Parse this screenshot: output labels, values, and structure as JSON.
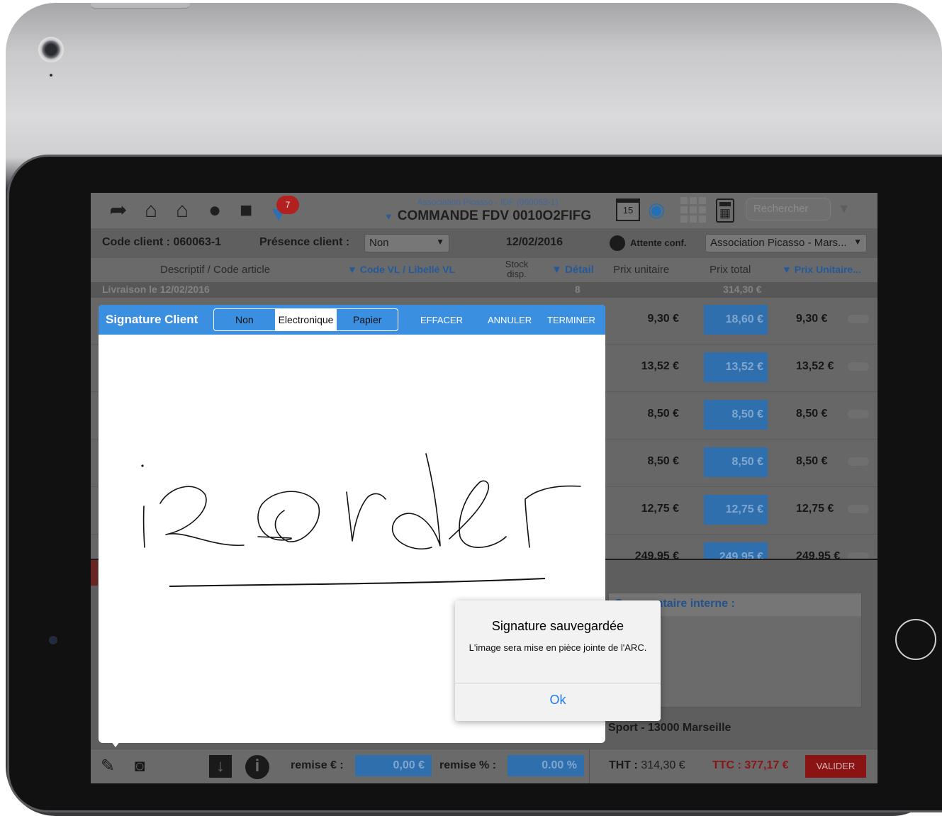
{
  "toolbar": {
    "cart_badge": "7",
    "doc_subtitle": "Association Picasso - IDF (060063-1)",
    "doc_title": "COMMANDE FDV 0010O2FIFG",
    "calendar_day": "15",
    "search_placeholder": "Rechercher"
  },
  "client": {
    "code_label": "Code client : 060063-1",
    "presence_label": "Présence client :",
    "presence_value": "Non",
    "date": "12/02/2016",
    "attente_label": "Attente conf.",
    "address_select": "Association Picasso - Mars..."
  },
  "table": {
    "headers": {
      "descriptif": "Descriptif / Code article",
      "code_vl": "▼ Code VL / Libellé VL",
      "stock": "Stock disp.",
      "detail": "▼ Détail",
      "prix_unitaire": "Prix unitaire",
      "prix_total": "Prix total",
      "prix_unitaire2": "▼ Prix Unitaire..."
    },
    "livraison": {
      "label": "Livraison le 12/02/2016",
      "qty": "8",
      "total": "314,30 €"
    },
    "rows": [
      {
        "pu": "9,30 €",
        "pt": "18,60 €",
        "pu2": "9,30 €"
      },
      {
        "pu": "13,52 €",
        "pt": "13,52 €",
        "pu2": "13,52 €"
      },
      {
        "pu": "8,50 €",
        "pt": "8,50 €",
        "pu2": "8,50 €"
      },
      {
        "pu": "8,50 €",
        "pt": "8,50 €",
        "pu2": "8,50 €"
      },
      {
        "pu": "12,75 €",
        "pt": "12,75 €",
        "pu2": "12,75 €"
      },
      {
        "pu": "249,95 €",
        "pt": "249,95 €",
        "pu2": "249,95 €"
      }
    ]
  },
  "lower": {
    "comment_header": "Commentaire interne :",
    "address": "Sport - 13000 Marseille"
  },
  "bottom": {
    "remise_eur_label": "remise € :",
    "remise_eur_value": "0,00 €",
    "remise_pct_label": "remise % :",
    "remise_pct_value": "0.00 %",
    "tht_label": "THT :",
    "tht_value": "314,30 €",
    "ttc": "TTC : 377,17 €",
    "valider": "VALIDER"
  },
  "signature": {
    "title": "Signature Client",
    "segments": [
      "Non",
      "Electronique",
      "Papier"
    ],
    "selected_segment": "Electronique",
    "effacer": "EFFACER",
    "annuler": "ANNULER",
    "terminer": "TERMINER"
  },
  "alert": {
    "title": "Signature sauvegardée",
    "message": "L'image sera mise en pièce jointe de l'ARC.",
    "ok": "Ok"
  },
  "colors": {
    "accent": "#3b8fe0",
    "valider": "#8a1414",
    "price_field": "#2f6fae",
    "alert_button": "#1b7bf2"
  }
}
